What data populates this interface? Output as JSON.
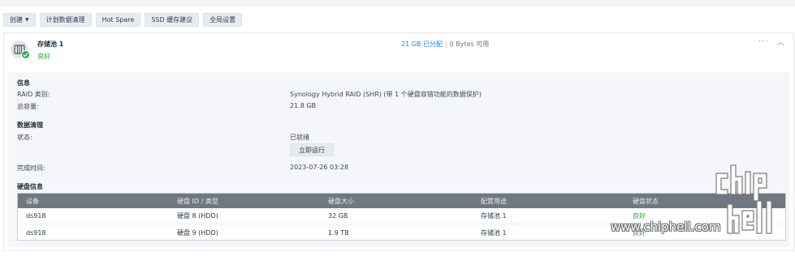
{
  "toolbar": {
    "create_label": "创建",
    "scrub_schedule_label": "计划数据清理",
    "hot_spare_label": "Hot Spare",
    "ssd_cache_label": "SSD 缓存建议",
    "global_settings_label": "全局设置"
  },
  "pool": {
    "name": "存储池 1",
    "status": "良好",
    "allocated": "21 GB 已分配",
    "separator": "|",
    "available": "0 Bytes 可用",
    "more_icon": "more-icon",
    "collapse_icon": "chevron-up-icon"
  },
  "info": {
    "title": "信息",
    "raid_type_label": "RAID 类别:",
    "raid_type_value": "Synology Hybrid RAID (SHR) (带 1 个硬盘容错功能的数据保护)",
    "capacity_label": "总容量:",
    "capacity_value": "21.8 GB"
  },
  "scrubbing": {
    "title": "数据清理",
    "status_label": "状态:",
    "status_value": "已就绪",
    "run_now_label": "立即运行",
    "completed_label": "完成时间:",
    "completed_value": "2023-07-26 03:28"
  },
  "disks": {
    "title": "硬盘信息",
    "columns": [
      "设备",
      "硬盘 ID / 类型",
      "硬盘大小",
      "配置用途",
      "硬盘状态"
    ],
    "rows": [
      [
        "ds918",
        "硬盘 8 (HDD)",
        "32 GB",
        "存储池 1",
        "良好"
      ],
      [
        "ds918",
        "硬盘 9 (HDD)",
        "1.9 TB",
        "存储池 1",
        "良好"
      ]
    ]
  },
  "watermark": {
    "logo_text": "chip hell",
    "url": "www.chiphell.com"
  },
  "colors": {
    "good": "#2aa22f",
    "accent": "#1c84d8",
    "table_header": "#6f7781"
  }
}
